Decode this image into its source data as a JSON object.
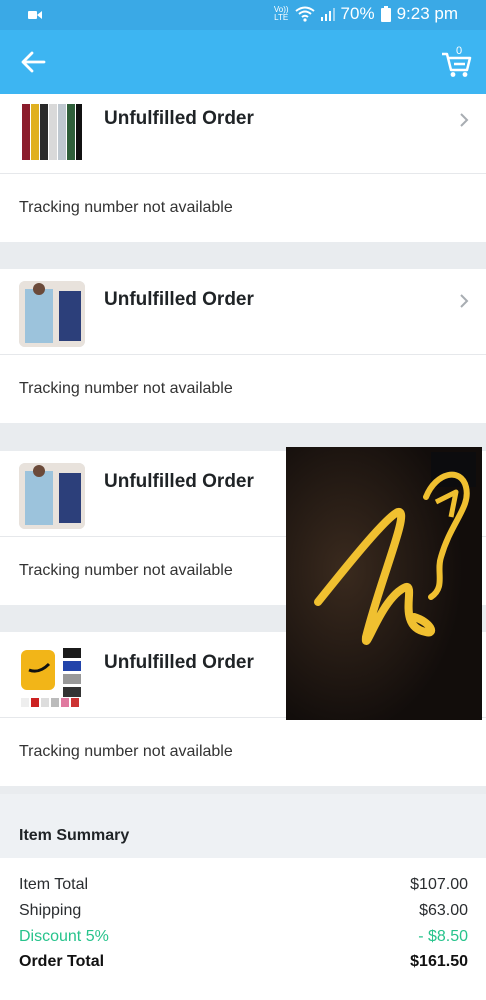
{
  "status_bar": {
    "network_label": "VoLTE",
    "network_top": "Vo))",
    "network_bottom": "LTE",
    "battery": "70%",
    "time": "9:23 pm"
  },
  "app_bar": {
    "back_icon": "arrow-left-icon",
    "cart_icon": "cart-icon",
    "cart_count": "0"
  },
  "orders": [
    {
      "title": "Unfulfilled Order",
      "tracking": "Tracking number not available",
      "thumb": "dresses-thumbnail"
    },
    {
      "title": "Unfulfilled Order",
      "tracking": "Tracking number not available",
      "thumb": "knit-dress-thumbnail"
    },
    {
      "title": "Unfulfilled Order",
      "tracking": "Tracking number not available",
      "thumb": "knit-dress-thumbnail"
    },
    {
      "title": "Unfulfilled Order",
      "tracking": "Tracking number not available",
      "thumb": "hoodie-set-thumbnail"
    }
  ],
  "summary": {
    "header": "Item Summary",
    "item_total_label": "Item Total",
    "item_total_value": "$107.00",
    "shipping_label": "Shipping",
    "shipping_value": "$63.00",
    "discount_label": "Discount 5%",
    "discount_value": "- $8.50",
    "order_total_label": "Order Total",
    "order_total_value": "$161.50"
  },
  "colors": {
    "status_bar": "#3aa9e6",
    "app_bar": "#3db5f2",
    "discount": "#27c38c"
  }
}
